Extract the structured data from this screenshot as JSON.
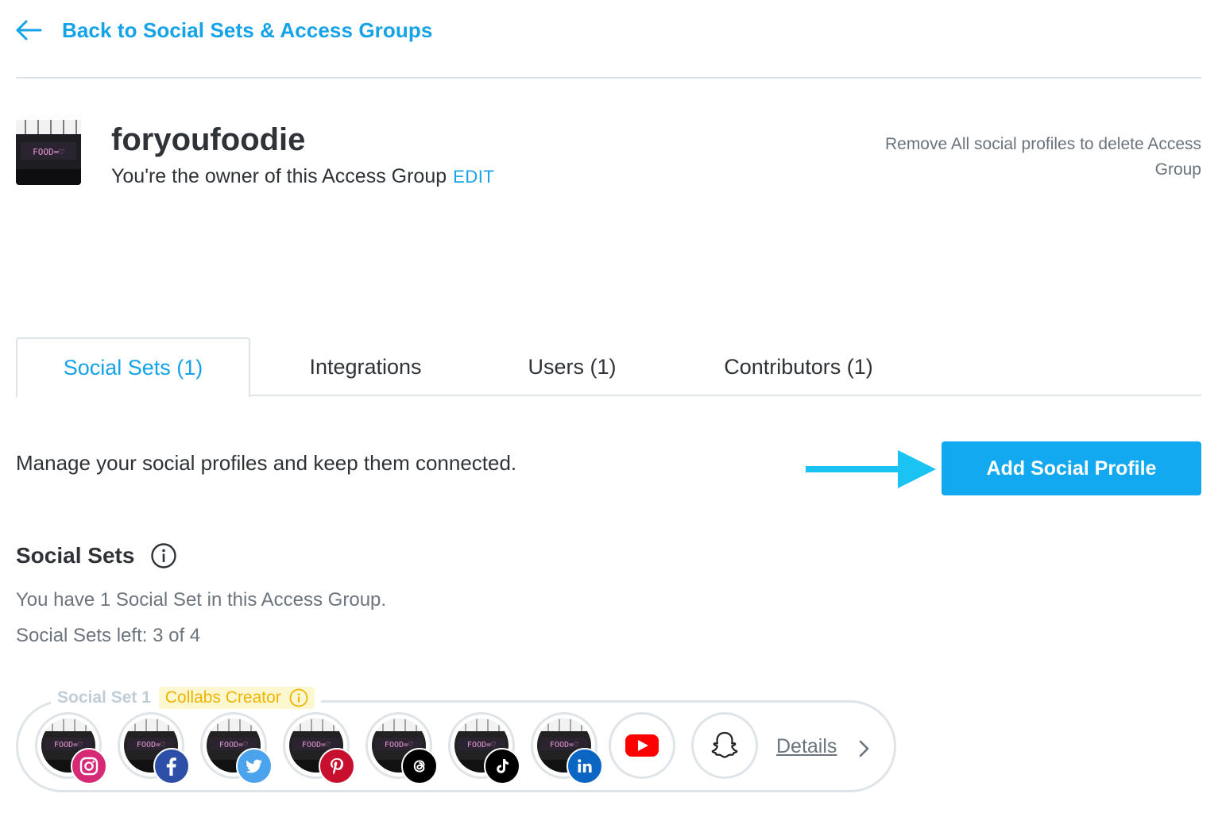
{
  "nav": {
    "back_label": "Back to Social Sets & Access Groups"
  },
  "group": {
    "name": "foryoufoodie",
    "owner_text": "You're the owner of this Access Group",
    "edit_label": "EDIT",
    "remove_note": "Remove All social profiles to delete Access Group",
    "avatar_text": "FOOD=♡"
  },
  "tabs": [
    {
      "label": "Social Sets (1)",
      "active": true
    },
    {
      "label": "Integrations",
      "active": false
    },
    {
      "label": "Users (1)",
      "active": false
    },
    {
      "label": "Contributors (1)",
      "active": false
    }
  ],
  "manage": {
    "description": "Manage your social profiles and keep them connected.",
    "add_button_label": "Add Social Profile"
  },
  "social_sets": {
    "heading": "Social Sets",
    "count_text": "You have 1 Social Set in this Access Group.",
    "left_text": "Social Sets left: 3 of 4",
    "set": {
      "label": "Social Set 1",
      "badge": "Collabs Creator",
      "profiles": [
        {
          "network": "instagram",
          "icon": "instagram-icon",
          "connected": true,
          "color": "#d62976"
        },
        {
          "network": "facebook",
          "icon": "facebook-icon",
          "connected": true,
          "color": "#2d4fa8"
        },
        {
          "network": "twitter",
          "icon": "twitter-icon",
          "connected": true,
          "color": "#4aa3ec"
        },
        {
          "network": "pinterest",
          "icon": "pinterest-icon",
          "connected": true,
          "color": "#c8102e"
        },
        {
          "network": "threads",
          "icon": "threads-icon",
          "connected": true,
          "color": "#000000"
        },
        {
          "network": "tiktok",
          "icon": "tiktok-icon",
          "connected": true,
          "color": "#000000"
        },
        {
          "network": "linkedin",
          "icon": "linkedin-icon",
          "connected": true,
          "color": "#0a66c2"
        },
        {
          "network": "youtube",
          "icon": "youtube-icon",
          "connected": false,
          "color": "#ff0000"
        },
        {
          "network": "snapchat",
          "icon": "snapchat-icon",
          "connected": false,
          "color": "#000000"
        }
      ],
      "details_label": "Details"
    }
  },
  "colors": {
    "accent": "#14a3e8",
    "button": "#12a9f0",
    "badge_text": "#f0b400",
    "badge_bg": "#fdf7d0"
  }
}
